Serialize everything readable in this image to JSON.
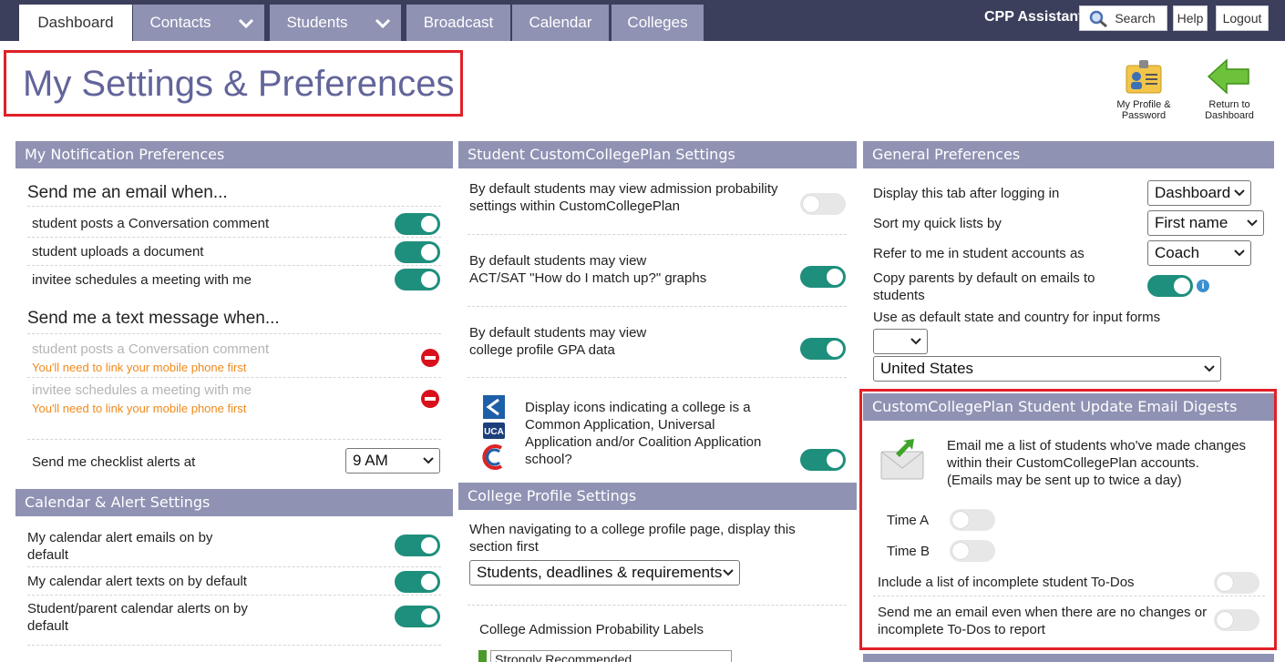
{
  "nav": {
    "tabs": [
      "Dashboard",
      "Contacts",
      "Students",
      "Broadcast",
      "Calendar",
      "Colleges"
    ],
    "assistant": "CPP Assistant",
    "search": "Search",
    "help": "Help",
    "logout": "Logout"
  },
  "page": {
    "title": "My Settings & Preferences",
    "profile_label_1": "My Profile &",
    "profile_label_2": "Password",
    "return_label_1": "Return to",
    "return_label_2": "Dashboard"
  },
  "notifications": {
    "header": "My Notification Preferences",
    "email_heading": "Send me an email when...",
    "email_items": [
      {
        "label": "student posts a Conversation comment",
        "on": true
      },
      {
        "label": "student uploads a document",
        "on": true
      },
      {
        "label": "invitee schedules a meeting with me",
        "on": true
      }
    ],
    "text_heading": "Send me a text message when...",
    "text_items": [
      {
        "label": "student posts a Conversation comment",
        "warning": "You'll need to link your mobile phone first"
      },
      {
        "label": "invitee schedules a meeting with me",
        "warning": "You'll need to link your mobile phone first"
      }
    ],
    "checklist_label": "Send me checklist alerts at",
    "checklist_value": "9 AM"
  },
  "calendar": {
    "header": "Calendar & Alert Settings",
    "items": [
      {
        "label_1": "My calendar alert emails on by",
        "label_2": "default",
        "on": true
      },
      {
        "label_1": "My calendar alert texts on by default",
        "label_2": "",
        "on": true
      },
      {
        "label_1": "Student/parent calendar alerts on by",
        "label_2": "default",
        "on": true
      }
    ]
  },
  "ccp": {
    "header": "Student CustomCollegePlan Settings",
    "items": [
      {
        "label_1": "By default students may view admission probability",
        "label_2": "settings within CustomCollegePlan",
        "on": false
      },
      {
        "label_1": "By default students may view",
        "label_2": "ACT/SAT \"How do I match up?\" graphs",
        "on": true
      },
      {
        "label_1": "By default students may view",
        "label_2": "college profile GPA data",
        "on": true
      }
    ],
    "icons_text": [
      "Display icons indicating a college is a",
      "Common Application, Universal",
      "Application and/or Coalition Application",
      "school?"
    ],
    "icons_on": true,
    "uca_label": "UCA"
  },
  "college_profile": {
    "header": "College Profile Settings",
    "label_1": "When navigating to a college profile page, display this",
    "label_2": "section first",
    "value": "Students, deadlines & requirements",
    "prob_label": "College Admission Probability Labels",
    "prob_first": "Strongly Recommended"
  },
  "general": {
    "header": "General Preferences",
    "rows": [
      {
        "label": "Display this tab after logging in",
        "value": "Dashboard"
      },
      {
        "label": "Sort my quick lists by",
        "value": "First name"
      },
      {
        "label": "Refer to me in student accounts as",
        "value": "Coach"
      }
    ],
    "copy_label_1": "Copy parents by default on emails to",
    "copy_label_2": "students",
    "copy_on": true,
    "state_label": "Use as default state and country for input forms",
    "state_value": "",
    "country_value": "United States"
  },
  "digest": {
    "header": "CustomCollegePlan Student Update Email Digests",
    "text": [
      "Email me a list of students who've made changes",
      "within their CustomCollegePlan accounts.",
      "(Emails may be sent up to twice a day)"
    ],
    "time_a": "Time A",
    "time_b": "Time B",
    "todo_label": "Include a list of incomplete student To-Dos",
    "nochange_1": "Send me an email even when there are no changes or",
    "nochange_2": "incomplete To-Dos to report",
    "time_a_on": false,
    "time_b_on": false,
    "todo_on": false,
    "nochange_on": false
  },
  "colors": {
    "accent": "#1e8f7c",
    "panel_header": "#8f92b3",
    "nav": "#3b3f5c",
    "title": "#62659a",
    "highlight": "#e02027"
  }
}
